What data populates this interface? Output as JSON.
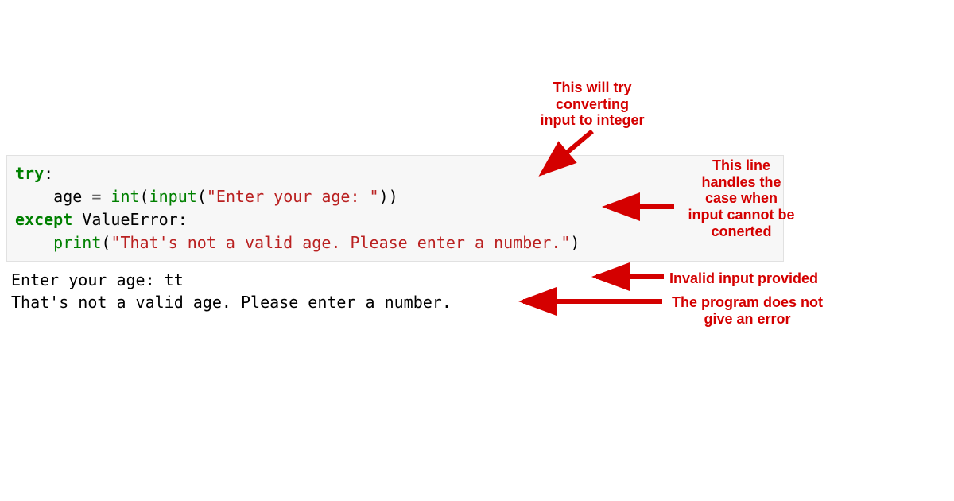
{
  "code": {
    "try_kw": "try",
    "colon": ":",
    "indent": "    ",
    "age_var": "age",
    "equals": " = ",
    "int_fn": "int",
    "input_fn": "input",
    "lparen": "(",
    "rparen": ")",
    "prompt_str": "\"Enter your age: \"",
    "except_kw": "except",
    "space": " ",
    "valueerror": "ValueError",
    "print_fn": "print",
    "err_str": "\"That's not a valid age. Please enter a number.\""
  },
  "output": {
    "line1": "Enter your age: tt",
    "line2": "That's not a valid age. Please enter a number."
  },
  "annotations": {
    "a1": "This will try\nconverting\ninput to integer",
    "a2": "This line\nhandles the\ncase when\ninput cannot be\nconerted",
    "a3": "Invalid input provided",
    "a4": "The program does not\ngive an error"
  },
  "colors": {
    "arrow": "#d40000"
  }
}
